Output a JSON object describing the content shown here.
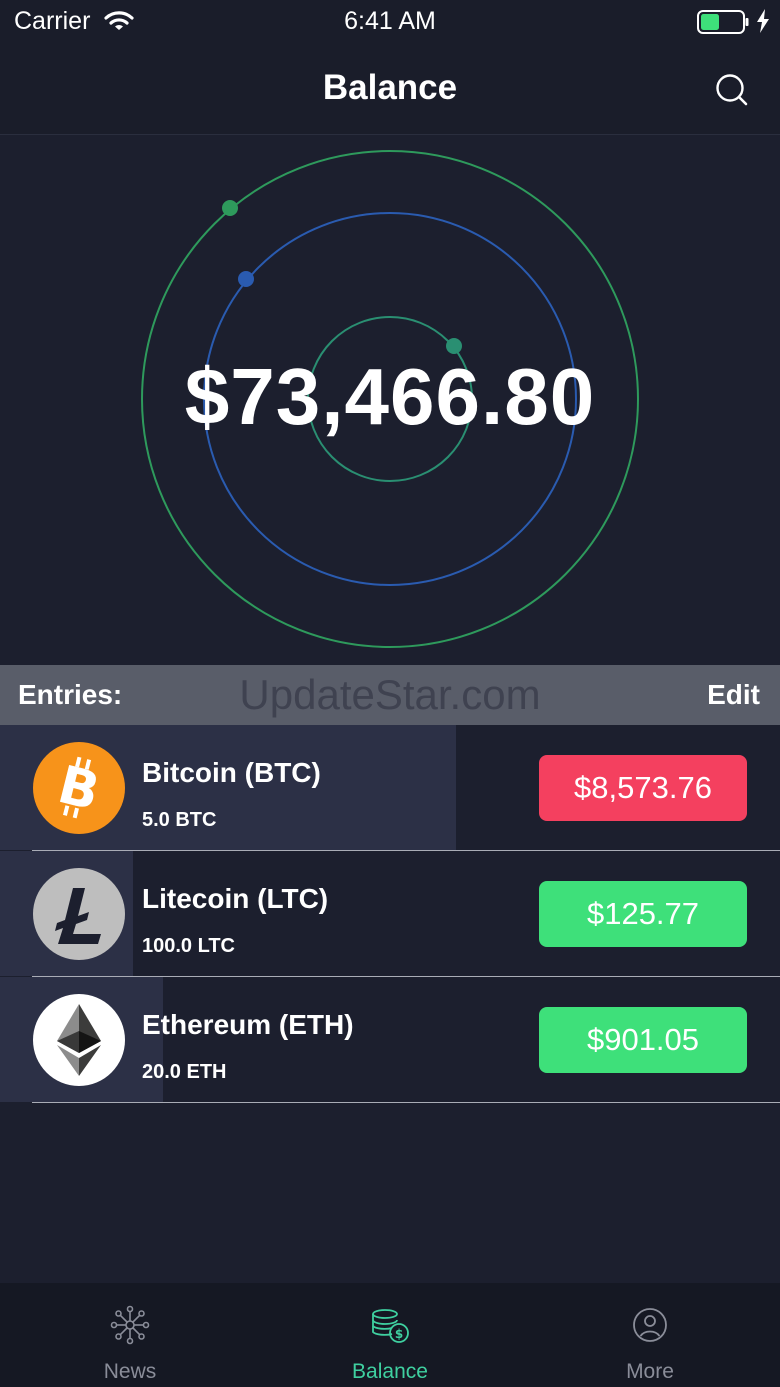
{
  "status_bar": {
    "carrier": "Carrier",
    "time": "6:41 AM",
    "battery_level": 0.45
  },
  "nav": {
    "title": "Balance",
    "search_icon": "search-icon"
  },
  "hero": {
    "total_balance": "$73,466.80",
    "colors": {
      "outer_orbit": "#2e9a5c",
      "middle_orbit": "#2a5bb0",
      "inner_orbit": "#2a8f72"
    }
  },
  "entries": {
    "header_label": "Entries:",
    "watermark": "UpdateStar.com",
    "edit_label": "Edit",
    "items": [
      {
        "name": "Bitcoin (BTC)",
        "amount": "5.0 BTC",
        "price": "$8,573.76",
        "price_color": "#f4405f",
        "icon": "bitcoin-icon"
      },
      {
        "name": "Litecoin (LTC)",
        "amount": "100.0 LTC",
        "price": "$125.77",
        "price_color": "#3ee07a",
        "icon": "litecoin-icon"
      },
      {
        "name": "Ethereum (ETH)",
        "amount": "20.0 ETH",
        "price": "$901.05",
        "price_color": "#3ee07a",
        "icon": "ethereum-icon"
      }
    ]
  },
  "tabs": [
    {
      "label": "News",
      "icon": "network-icon",
      "active": false
    },
    {
      "label": "Balance",
      "icon": "coins-icon",
      "active": true
    },
    {
      "label": "More",
      "icon": "profile-icon",
      "active": false
    }
  ],
  "colors": {
    "background": "#1c1f2e",
    "accent": "#3fd0a0",
    "inactive_tab": "#8a8d99"
  }
}
